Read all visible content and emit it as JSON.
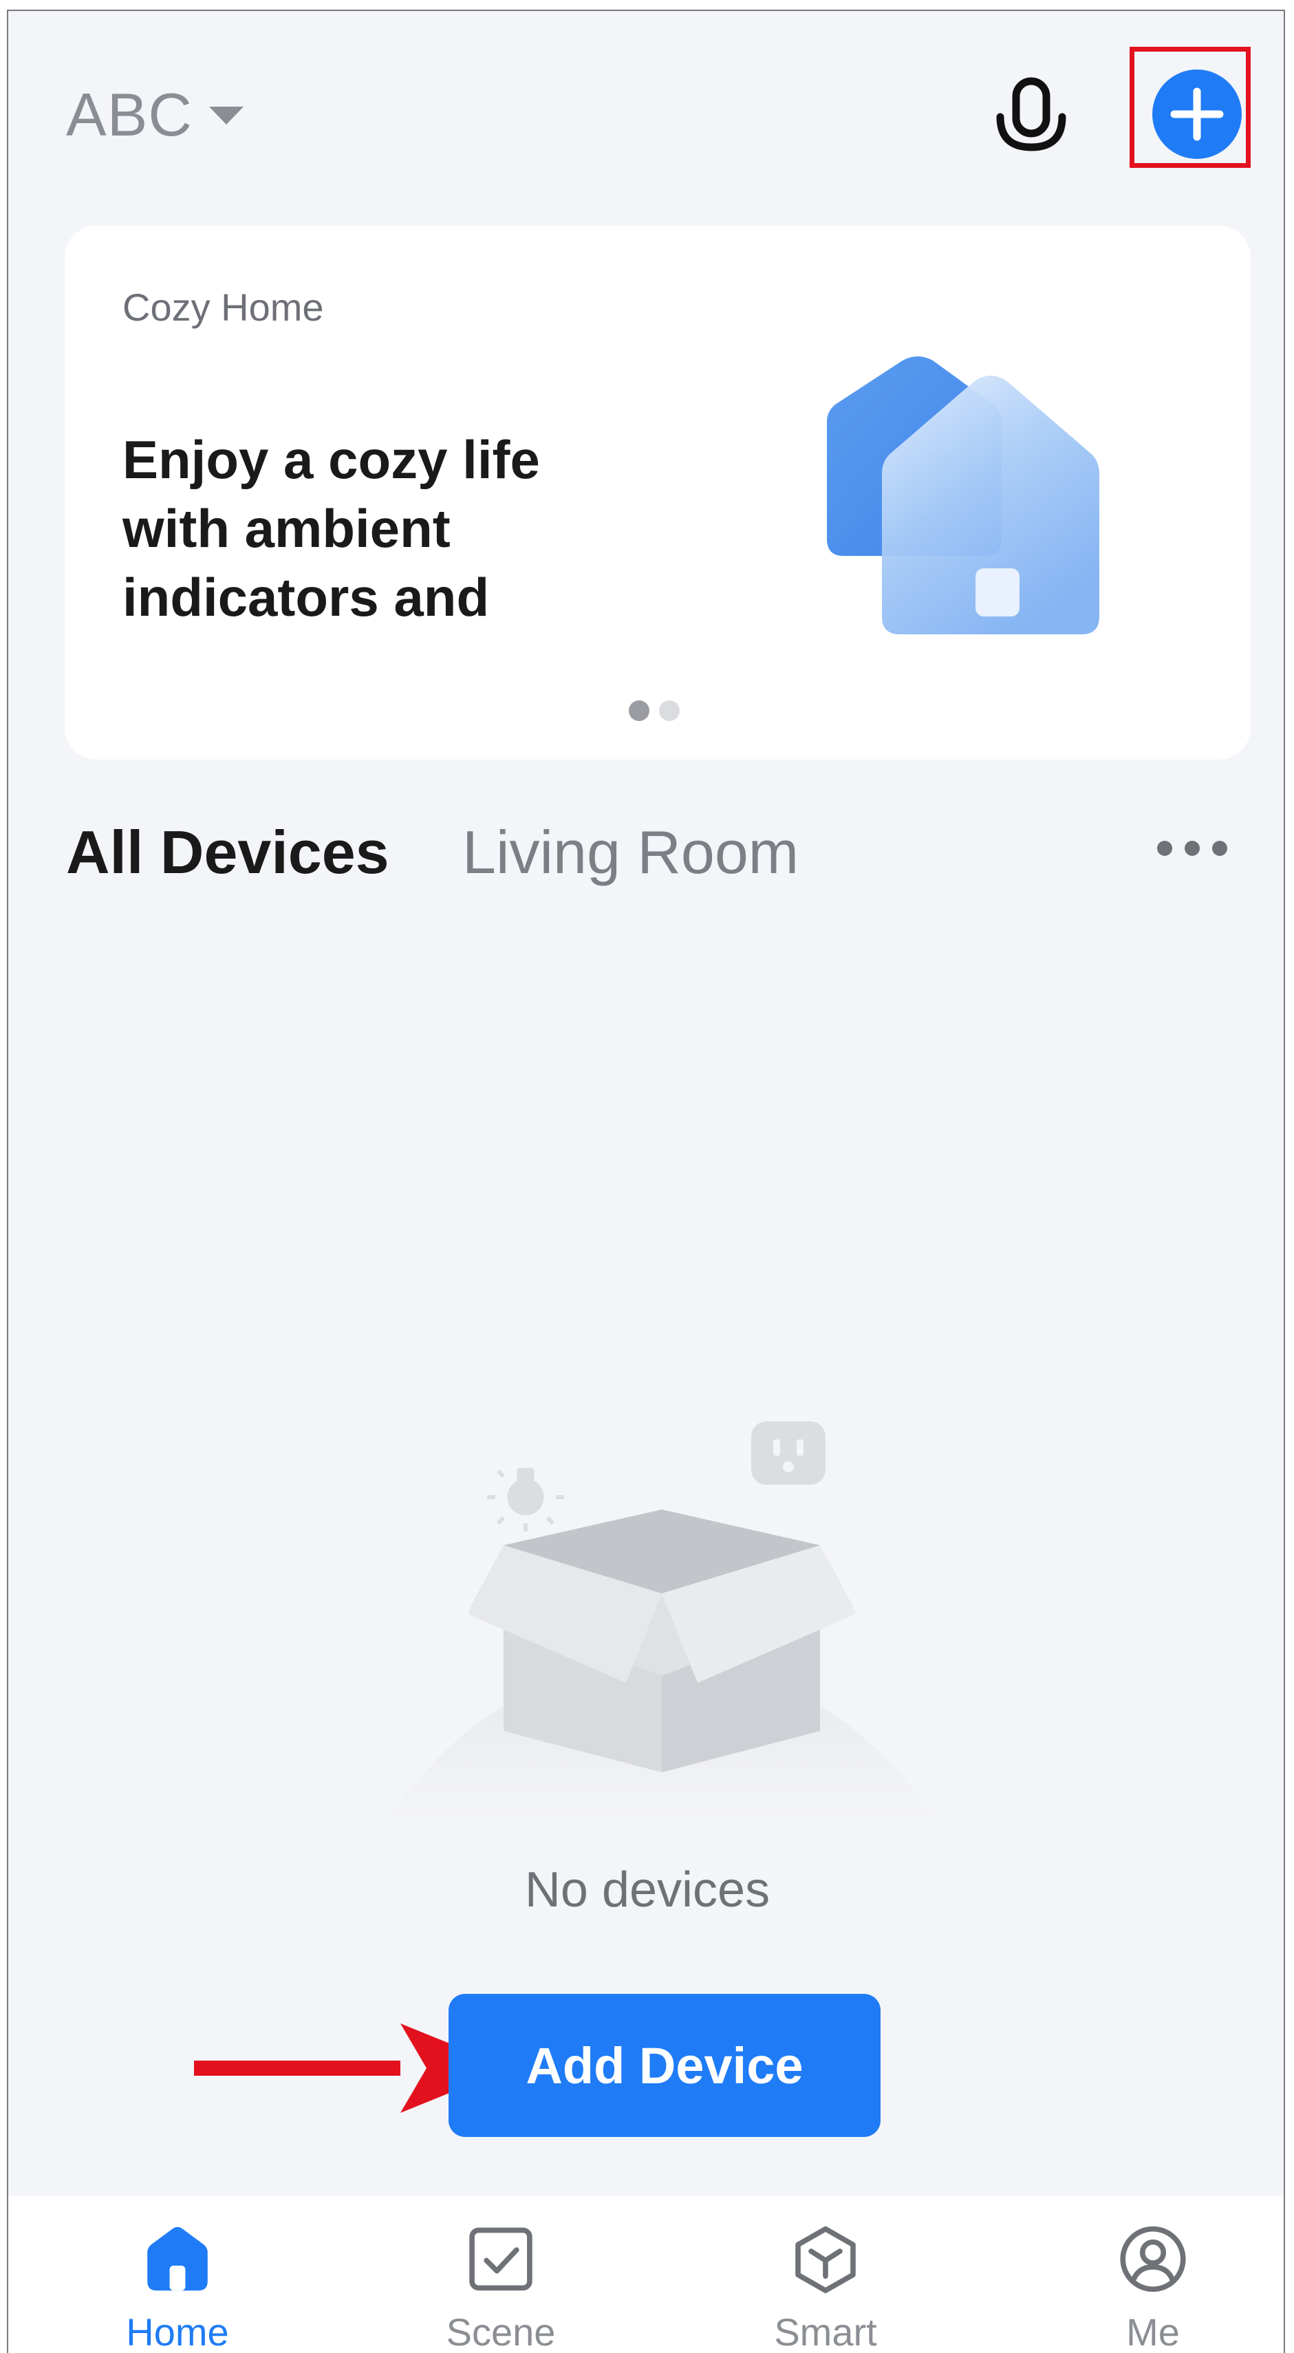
{
  "header": {
    "home_name": "ABC",
    "home_caret_icon": "caret-down-icon",
    "voice_icon": "microphone-icon",
    "add_icon": "plus-circle-icon"
  },
  "banner": {
    "eyebrow": "Cozy Home",
    "headline": "Enjoy a cozy life with ambient indicators and",
    "illustration_icon": "home-illustration",
    "pagination": {
      "total": 2,
      "active": 1
    }
  },
  "rooms": {
    "tabs": [
      "All Devices",
      "Living Room"
    ],
    "active": "All Devices",
    "more_icon": "more-horizontal-icon"
  },
  "empty_state": {
    "illustration_icon": "empty-box-illustration",
    "message": "No devices",
    "button_label": "Add Device"
  },
  "annotations": {
    "highlight_color": "#e3101e",
    "arrow_color": "#e3101e"
  },
  "bottom_nav": {
    "items": [
      {
        "label": "Home",
        "icon": "home-icon",
        "active": true
      },
      {
        "label": "Scene",
        "icon": "scene-checkbox-icon",
        "active": false
      },
      {
        "label": "Smart",
        "icon": "smart-hexagon-icon",
        "active": false
      },
      {
        "label": "Me",
        "icon": "user-profile-icon",
        "active": false
      }
    ]
  },
  "colors": {
    "accent": "#1f7cf6",
    "background": "#f4f5f9",
    "text_primary": "#1a1a1a",
    "text_secondary": "#7c7f85"
  }
}
